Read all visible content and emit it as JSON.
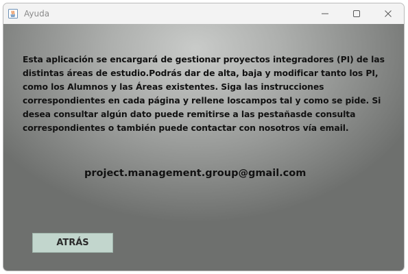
{
  "window": {
    "title": "Ayuda",
    "icons": [
      "java-app-icon",
      "minimize-icon",
      "maximize-icon",
      "close-icon"
    ]
  },
  "help": {
    "lines": [
      "Esta aplicación se encargará de gestionar proyectos integradores (PI) de las",
      "distintas áreas de estudio.Podrás dar de alta, baja y modificar tanto los PI,",
      "como los Alumnos y las Áreas existentes. Siga las instrucciones",
      "correspondientes en cada página y rellene loscampos tal y como se pide. Si",
      "desea consultar algún dato puede remitirse a las pestañasde consulta",
      "correspondientes o también puede contactar con nosotros vía email."
    ],
    "email": "project.management.group@gmail.com"
  },
  "buttons": {
    "back_label": "ATRÁS"
  },
  "colors": {
    "button_bg": "#c2d6cd",
    "text": "#111111"
  }
}
